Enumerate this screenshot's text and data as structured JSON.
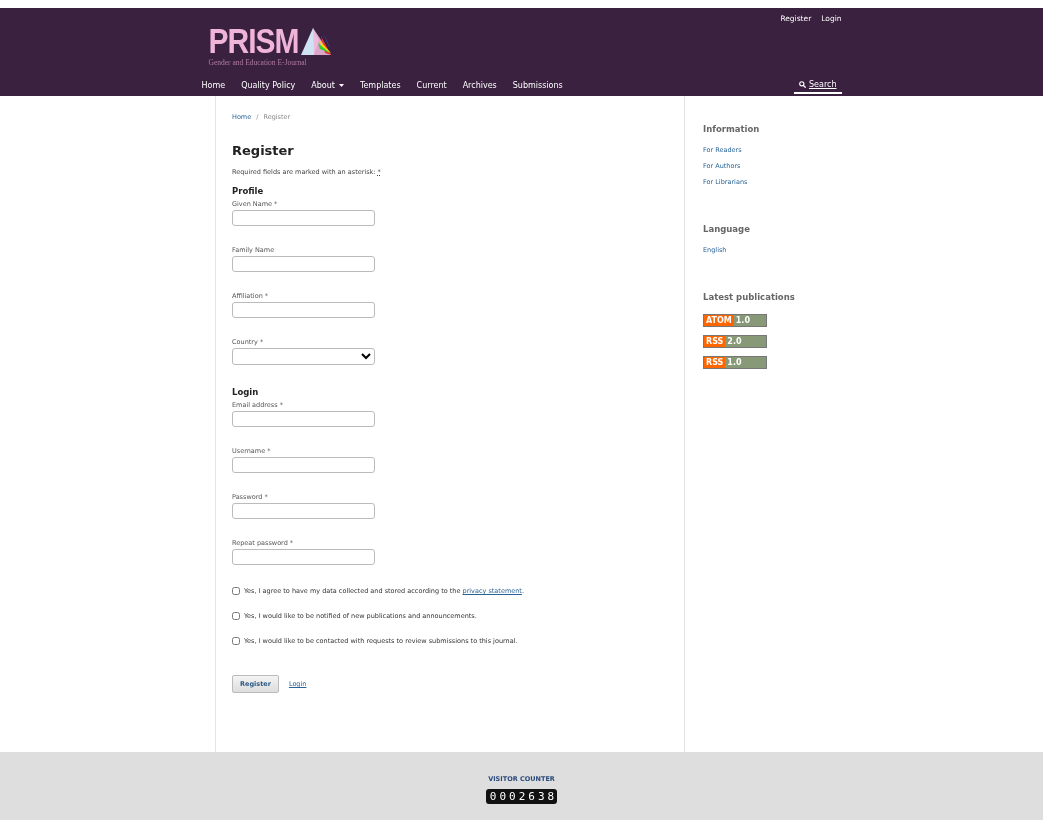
{
  "header": {
    "user_links": [
      "Register",
      "Login"
    ],
    "logo": {
      "text": "PRISM",
      "subtitle": "Gender and Education E-Journal"
    },
    "nav": [
      {
        "label": "Home",
        "dropdown": false
      },
      {
        "label": "Quality Policy",
        "dropdown": false
      },
      {
        "label": "About",
        "dropdown": true
      },
      {
        "label": "Templates",
        "dropdown": false
      },
      {
        "label": "Current",
        "dropdown": false
      },
      {
        "label": "Archives",
        "dropdown": false
      },
      {
        "label": "Submissions",
        "dropdown": false
      }
    ],
    "search": "Search"
  },
  "breadcrumb": [
    "Home",
    "Register"
  ],
  "breadcrumb_separator": "/",
  "title": "Register",
  "required_note": "Required fields are marked with an asterisk: ",
  "required_mark": "*",
  "sections": [
    {
      "heading": "Profile",
      "fields": [
        {
          "label": "Given Name *",
          "kind": "text"
        },
        {
          "label": "Family Name",
          "kind": "text"
        },
        {
          "label": "Affiliation *",
          "kind": "text"
        },
        {
          "label": "Country *",
          "kind": "select"
        }
      ]
    },
    {
      "heading": "Login",
      "fields": [
        {
          "label": "Email address *",
          "kind": "text"
        },
        {
          "label": "Username *",
          "kind": "text"
        },
        {
          "label": "Password *",
          "kind": "text"
        },
        {
          "label": "Repeat password *",
          "kind": "text"
        }
      ]
    }
  ],
  "consents": [
    {
      "text": "Yes, I agree to have my data collected and stored according to the ",
      "link": "privacy statement",
      "after": ".",
      "checked": false
    },
    {
      "text": "Yes, I would like to be notified of new publications and announcements.",
      "checked": false
    },
    {
      "text": "Yes, I would like to be contacted with requests to review submissions to this journal.",
      "checked": false
    }
  ],
  "submit": "Register",
  "login_link": "Login",
  "sidebar": [
    {
      "heading": "Information",
      "kind": "links",
      "items": [
        "For Readers",
        "For Authors",
        "For Librarians"
      ]
    },
    {
      "heading": "Language",
      "kind": "links",
      "items": [
        "English"
      ]
    },
    {
      "heading": "Latest publications",
      "kind": "feeds",
      "items": [
        {
          "tag": "ATOM",
          "version": "1.0"
        },
        {
          "tag": "RSS",
          "version": "2.0"
        },
        {
          "tag": "RSS",
          "version": "1.0"
        }
      ]
    }
  ],
  "footer": {
    "counter_title": "VISITOR COUNTER",
    "counter": "0002638"
  }
}
